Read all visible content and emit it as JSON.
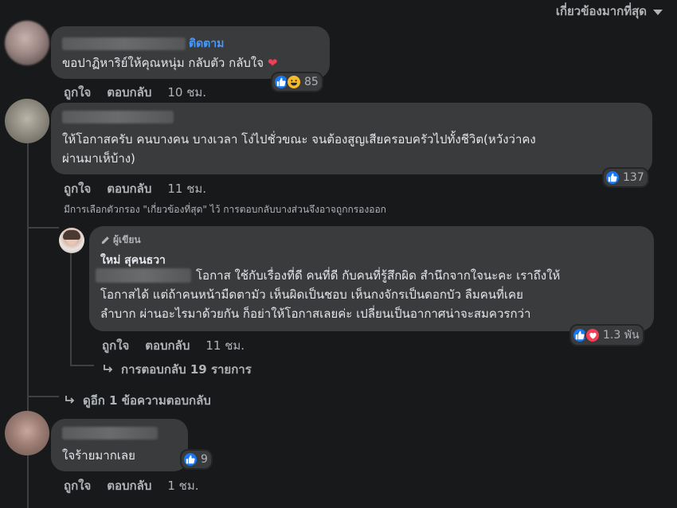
{
  "sort": {
    "label": "เกี่ยวข้องมากที่สุด"
  },
  "comments": [
    {
      "follow": "ติดตาม",
      "text": "ขอปาฏิหาริย์ให้คุณหนุ่ม กลับตัว กลับใจ",
      "reactions": "85",
      "like": "ถูกใจ",
      "reply": "ตอบกลับ",
      "time": "10 ชม."
    },
    {
      "text_line1": "ให้โอกาสครับ คนบางคน บางเวลา โง่ไปชั่วขณะ จนต้องสูญเสียครอบครัวไปทั้งชีวิต(หวังว่าคง",
      "text_line2": "ผ่านมาเห็บ้าง)",
      "reactions": "137",
      "like": "ถูกใจ",
      "reply": "ตอบกลับ",
      "time": "11 ชม.",
      "filter_note": "มีการเลือกตัวกรอง \"เกี่ยวข้องที่สุด\" ไว้ การตอบกลับบางส่วนจึงอาจถูกกรองออก",
      "author_reply": {
        "badge": "ผู้เขียน",
        "name": "ใหม่ สุคนธวา",
        "line1": "โอกาส ใช้กับเรื่องที่ดี คนที่ดี กับคนที่รู้สึกผิด สำนึกจากใจนะคะ เราถึงให้",
        "line2": "โอกาสได้ แต่ถ้าคนหน้ามืดตามัว เห็นผิดเป็นชอบ เห็นกงจักรเป็นดอกบัว ลืมคนที่เคย",
        "line3": "ลำบาก ผ่านอะไรมาด้วยกัน ก็อย่าให้โอกาสเลยค่ะ เปลี่ยนเป็นอากาศน่าจะสมควรกว่า",
        "reactions": "1.3 พัน",
        "like": "ถูกใจ",
        "reply": "ตอบกลับ",
        "time": "11 ชม."
      },
      "more_replies": "การตอบกลับ 19 รายการ",
      "view_more": "ดูอีก 1 ข้อความตอบกลับ"
    },
    {
      "text": "ใจร้ายมากเลย",
      "reactions": "9",
      "like": "ถูกใจ",
      "reply": "ตอบกลับ",
      "time": "1 ชม."
    }
  ]
}
